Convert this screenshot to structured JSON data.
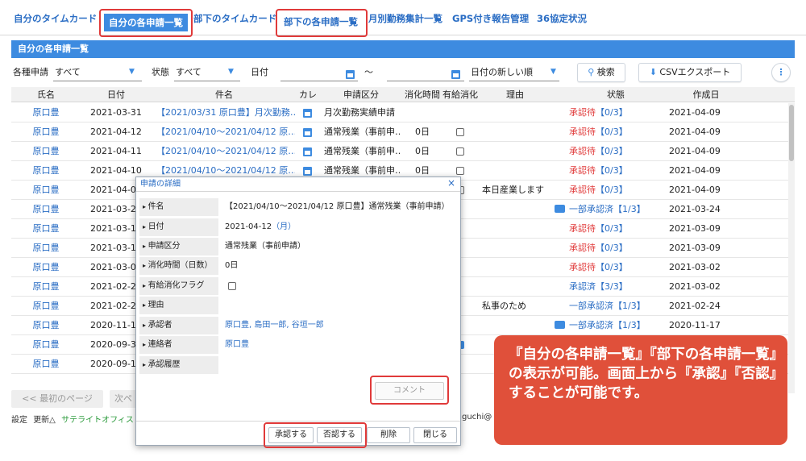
{
  "tabs": [
    "自分のタイムカード",
    "自分の各申請一覧",
    "部下のタイムカード",
    "部下の各申請一覧",
    "月別勤務集計一覧",
    "GPS付き報告管理",
    "36協定状況"
  ],
  "section_title": "自分の各申請一覧",
  "filters": {
    "type_label": "各種申請",
    "type_value": "すべて",
    "status_label": "状態",
    "status_value": "すべて",
    "date_label": "日付",
    "range_sep": "～",
    "sort_value": "日付の新しい順",
    "search_button": "検索",
    "csv_button": "CSVエクスポート",
    "more_icon": "more-vertical-icon"
  },
  "table": {
    "headers": [
      "氏名",
      "日付",
      "件名",
      "カレ",
      "申請区分",
      "消化時間",
      "有給消化",
      "理由",
      "状態",
      "作成日"
    ],
    "rows": [
      {
        "name": "原口豊",
        "date": "2021-03-31",
        "subject": "【2021/03/31 原口豊】月次勤務…",
        "cal": true,
        "kind": "月次勤務実績申請",
        "hours": "",
        "check": "none",
        "reason": "",
        "chat": false,
        "status": "承認待",
        "status_link": "【0/3】",
        "created": "2021-04-09"
      },
      {
        "name": "原口豊",
        "date": "2021-04-12",
        "subject": "【2021/04/10～2021/04/12 原…",
        "cal": true,
        "kind": "通常残業（事前申…",
        "hours": "0日",
        "check": "off",
        "reason": "",
        "chat": false,
        "status": "承認待",
        "status_link": "【0/3】",
        "created": "2021-04-09"
      },
      {
        "name": "原口豊",
        "date": "2021-04-11",
        "subject": "【2021/04/10～2021/04/12 原…",
        "cal": true,
        "kind": "通常残業（事前申…",
        "hours": "0日",
        "check": "off",
        "reason": "",
        "chat": false,
        "status": "承認待",
        "status_link": "【0/3】",
        "created": "2021-04-09"
      },
      {
        "name": "原口豊",
        "date": "2021-04-10",
        "subject": "【2021/04/10～2021/04/12 原…",
        "cal": true,
        "kind": "通常残業（事前申…",
        "hours": "0日",
        "check": "off",
        "reason": "",
        "chat": false,
        "status": "承認待",
        "status_link": "【0/3】",
        "created": "2021-04-09"
      },
      {
        "name": "原口豊",
        "date": "2021-04-0",
        "subject": "",
        "cal": false,
        "kind": "",
        "hours": "",
        "check": "off",
        "reason": "本日産業します",
        "chat": false,
        "status": "承認待",
        "status_link": "【0/3】",
        "created": "2021-04-09"
      },
      {
        "name": "原口豊",
        "date": "2021-03-2",
        "subject": "",
        "cal": false,
        "kind": "",
        "hours": "",
        "check": "none",
        "reason": "",
        "chat": true,
        "status": "",
        "status_link": "一部承認済【1/3】",
        "created": "2021-03-24"
      },
      {
        "name": "原口豊",
        "date": "2021-03-1",
        "subject": "",
        "cal": false,
        "kind": "",
        "hours": "",
        "check": "none",
        "reason": "",
        "chat": false,
        "status": "承認待",
        "status_link": "【0/3】",
        "created": "2021-03-09"
      },
      {
        "name": "原口豊",
        "date": "2021-03-1",
        "subject": "",
        "cal": false,
        "kind": "",
        "hours": "",
        "check": "none",
        "reason": "",
        "chat": false,
        "status": "承認待",
        "status_link": "【0/3】",
        "created": "2021-03-09"
      },
      {
        "name": "原口豊",
        "date": "2021-03-0",
        "subject": "",
        "cal": false,
        "kind": "",
        "hours": "",
        "check": "none",
        "reason": "",
        "chat": false,
        "status": "承認待",
        "status_link": "【0/3】",
        "created": "2021-03-02"
      },
      {
        "name": "原口豊",
        "date": "2021-02-2",
        "subject": "",
        "cal": false,
        "kind": "",
        "hours": "",
        "check": "none",
        "reason": "",
        "chat": false,
        "status": "",
        "status_link": "承認済【3/3】",
        "created": "2021-03-02"
      },
      {
        "name": "原口豊",
        "date": "2021-02-2",
        "subject": "",
        "cal": false,
        "kind": "",
        "hours": "",
        "check": "none",
        "reason": "私事のため",
        "chat": false,
        "status": "",
        "status_link": "一部承認済【1/3】",
        "created": "2021-02-24"
      },
      {
        "name": "原口豊",
        "date": "2020-11-1",
        "subject": "",
        "cal": false,
        "kind": "",
        "hours": "",
        "check": "none",
        "reason": "",
        "chat": true,
        "status": "",
        "status_link": "一部承認済【1/3】",
        "created": "2020-11-17"
      },
      {
        "name": "原口豊",
        "date": "2020-09-3",
        "subject": "",
        "cal": false,
        "kind": "",
        "hours": "",
        "check": "on",
        "reason": "",
        "chat": false,
        "status": "",
        "status_link": "",
        "created": ""
      },
      {
        "name": "原口豊",
        "date": "2020-09-1",
        "subject": "",
        "cal": false,
        "kind": "",
        "hours": "",
        "check": "none",
        "reason": "",
        "chat": false,
        "status": "",
        "status_link": "",
        "created": ""
      }
    ]
  },
  "pager": {
    "first": "<< 最初のページ",
    "next": "次ペ"
  },
  "footer": {
    "settings": "設定",
    "updated": "更新△",
    "satellite": "サテライトオフィス",
    "email_fragment": "guchi@"
  },
  "dialog": {
    "title": "申請の詳細",
    "close_icon": "close-icon",
    "fields": [
      {
        "label": "件名",
        "value": "【2021/04/10～2021/04/12 原口豊】通常残業（事前申請）"
      },
      {
        "label": "日付",
        "value": "2021-04-12",
        "value_link": "（月）"
      },
      {
        "label": "申請区分",
        "value": "通常残業（事前申請）"
      },
      {
        "label": "消化時間（日数）",
        "value": "0日"
      },
      {
        "label": "有給消化フラグ",
        "value": ""
      },
      {
        "label": "理由",
        "value": ""
      },
      {
        "label": "承認者",
        "value": "原口豊, 島田一郎, 谷垣一郎"
      },
      {
        "label": "連絡者",
        "value": "原口豊"
      },
      {
        "label": "承認履歴",
        "value": ""
      }
    ],
    "comment_button": "コメント",
    "buttons": [
      "承認する",
      "否認する",
      "削除",
      "閉じる"
    ]
  },
  "callout": {
    "text": "『自分の各申請一覧』『部下の各申請一覧』の表示が可能。画面上から『承認』『否認』することが可能です。"
  },
  "colors": {
    "accent": "#3d8be0",
    "link": "#2a6dc4",
    "pending": "#e03a3a",
    "callout": "#e0503a",
    "highlight_box": "#e03a3a"
  }
}
